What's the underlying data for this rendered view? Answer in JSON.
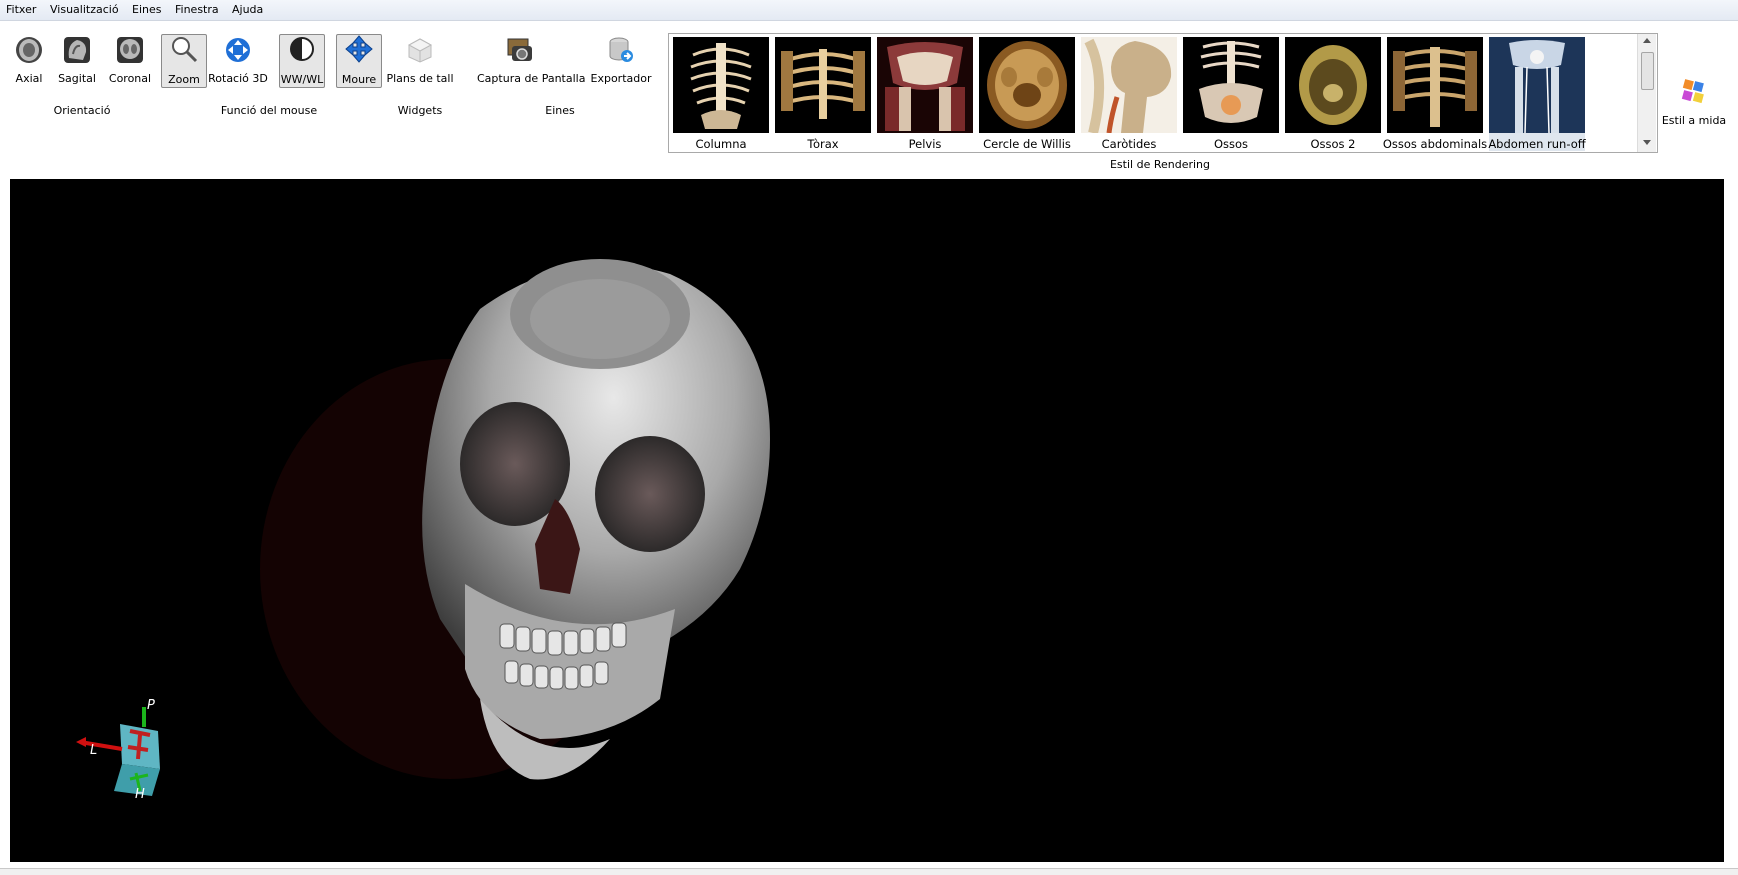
{
  "menu": [
    "Fitxer",
    "Visualització",
    "Eines",
    "Finestra",
    "Ajuda"
  ],
  "toolbar": {
    "orientation": {
      "group_label": "Orientació",
      "axial": "Axial",
      "sagital": "Sagital",
      "coronal": "Coronal"
    },
    "mouse": {
      "group_label": "Funció del mouse",
      "zoom": "Zoom",
      "rotacio3d": "Rotació 3D",
      "wwwl": "WW/WL",
      "moure": "Moure"
    },
    "widgets": {
      "group_label": "Widgets",
      "plans_de_tall": "Plans de tall"
    },
    "eines": {
      "group_label": "Eines",
      "captura": "Captura de Pantalla",
      "exportador": "Exportador"
    }
  },
  "rendering": {
    "group_label": "Estil de Rendering",
    "styles": [
      "Columna",
      "Tòrax",
      "Pelvis",
      "Cercle de Willis",
      "Caròtides",
      "Ossos",
      "Ossos 2",
      "Ossos abdominals",
      "Abdomen run-off"
    ],
    "selected": "Abdomen run-off"
  },
  "custom_style": {
    "label": "Estil a mida"
  },
  "orientation_marker": {
    "p": "P",
    "l": "L",
    "h": "H"
  },
  "colors": {
    "menubar": "#e8edf5",
    "viewport": "#000000",
    "selected_bg": "#dfe6ee",
    "accent_blue": "#1f6fd6"
  }
}
